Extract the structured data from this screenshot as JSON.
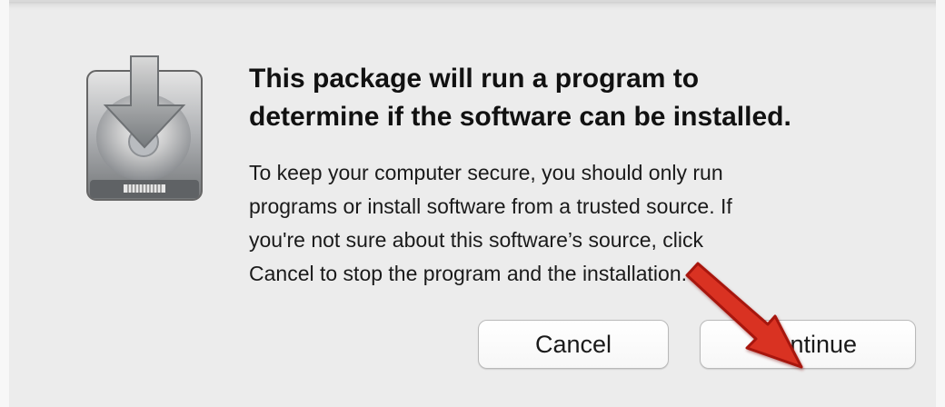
{
  "dialog": {
    "title": "This package will run a program to\ndetermine if the software can be installed.",
    "message": "To keep your computer secure, you should only run\nprograms or install software from a trusted source. If\nyou're not sure about this software’s source, click\nCancel to stop the program and the installation.",
    "buttons": {
      "cancel_label": "Cancel",
      "continue_label": "Continue"
    },
    "icon": "installer-disk-download-icon"
  },
  "annotation": {
    "icon": "red-pointer-arrow-icon",
    "color": "#d93024"
  },
  "colors": {
    "dialog_background": "#ececec",
    "button_background": "#ffffff",
    "title_text": "#111111",
    "annotation_red": "#d93024"
  }
}
